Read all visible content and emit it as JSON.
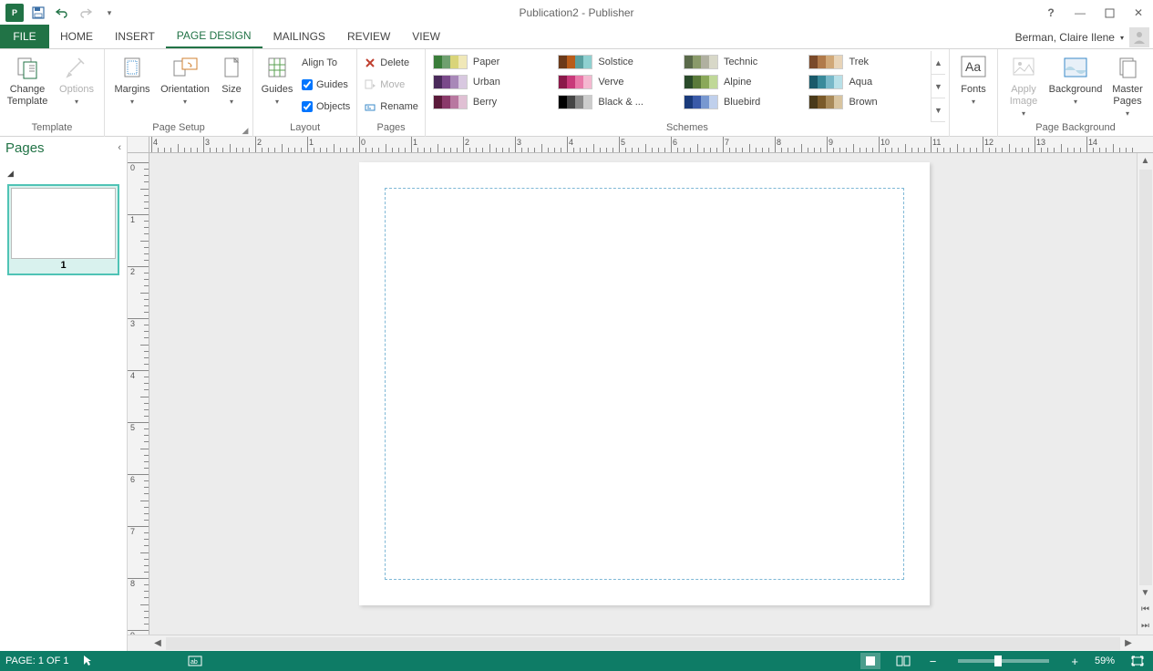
{
  "title": "Publication2 - Publisher",
  "user": "Berman, Claire Ilene",
  "tabs": [
    "FILE",
    "HOME",
    "INSERT",
    "PAGE DESIGN",
    "MAILINGS",
    "REVIEW",
    "VIEW"
  ],
  "activeTab": 3,
  "ribbon": {
    "template": {
      "change": "Change\nTemplate",
      "options": "Options",
      "label": "Template"
    },
    "pageSetup": {
      "margins": "Margins",
      "orientation": "Orientation",
      "size": "Size",
      "label": "Page Setup"
    },
    "layout": {
      "guides": "Guides",
      "alignTo": "Align To",
      "cbGuides": "Guides",
      "cbObjects": "Objects",
      "label": "Layout"
    },
    "pages": {
      "delete": "Delete",
      "move": "Move",
      "rename": "Rename",
      "label": "Pages"
    },
    "schemes": {
      "label": "Schemes",
      "items": [
        {
          "name": "Paper",
          "c": [
            "#3a7d3a",
            "#6fa06f",
            "#d9d47a",
            "#f0e8b8"
          ]
        },
        {
          "name": "Solstice",
          "c": [
            "#6b3a1a",
            "#b85c1a",
            "#5aa0a0",
            "#8fd0d0"
          ]
        },
        {
          "name": "Technic",
          "c": [
            "#5a6a4a",
            "#8a9a6a",
            "#b0b0a0",
            "#d8d8c8"
          ]
        },
        {
          "name": "Trek",
          "c": [
            "#7a4a2a",
            "#b07a4a",
            "#d0a878",
            "#e8d4b8"
          ]
        },
        {
          "name": "Urban",
          "c": [
            "#4a2a5a",
            "#7a4a8a",
            "#a888b8",
            "#d8c8e0"
          ]
        },
        {
          "name": "Verve",
          "c": [
            "#8a1a4a",
            "#c83a7a",
            "#e878a8",
            "#f4b8d0"
          ]
        },
        {
          "name": "Alpine",
          "c": [
            "#2a4a2a",
            "#5a7a3a",
            "#8aa85a",
            "#c0d898"
          ]
        },
        {
          "name": "Aqua",
          "c": [
            "#1a5a6a",
            "#3a8a9a",
            "#78b8c8",
            "#b8e0e8"
          ]
        },
        {
          "name": "Berry",
          "c": [
            "#5a1a3a",
            "#8a3a6a",
            "#b878a0",
            "#e0c0d4"
          ]
        },
        {
          "name": "Black & ...",
          "c": [
            "#000000",
            "#444444",
            "#888888",
            "#cccccc"
          ]
        },
        {
          "name": "Bluebird",
          "c": [
            "#1a3a7a",
            "#3a5aa8",
            "#7898d0",
            "#c0d0ec"
          ]
        },
        {
          "name": "Brown",
          "c": [
            "#4a3a1a",
            "#7a5a2a",
            "#a88a5a",
            "#d8c4a0"
          ]
        }
      ]
    },
    "fonts": {
      "label": "Fonts"
    },
    "pageBackground": {
      "apply": "Apply\nImage",
      "background": "Background",
      "master": "Master\nPages",
      "label": "Page Background"
    }
  },
  "pagesPanel": {
    "title": "Pages",
    "pageNum": "1"
  },
  "statusbar": {
    "page": "PAGE: 1 OF 1",
    "zoom": "59%"
  }
}
